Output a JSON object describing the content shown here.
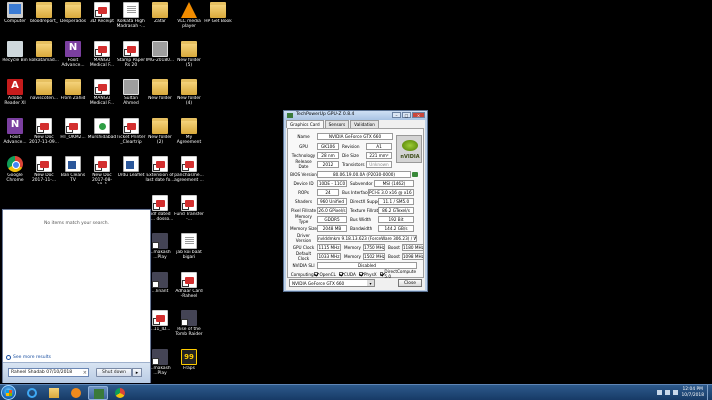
{
  "desktop": {
    "icons": [
      {
        "label": "Computer",
        "type": "computer",
        "col": 0,
        "row": 0
      },
      {
        "label": "bloodreport_",
        "type": "folder",
        "col": 1,
        "row": 0
      },
      {
        "label": "Desperados",
        "type": "folder",
        "col": 2,
        "row": 0
      },
      {
        "label": "3D Receipt",
        "type": "pdf",
        "col": 3,
        "row": 0
      },
      {
        "label": "Kolkata High Madrasah -...",
        "type": "doc",
        "col": 4,
        "row": 0
      },
      {
        "label": "Zafar",
        "type": "folder",
        "col": 5,
        "row": 0
      },
      {
        "label": "VLC media player",
        "type": "vlc",
        "col": 6,
        "row": 0
      },
      {
        "label": "HP Get Book",
        "type": "folder",
        "col": 7,
        "row": 0
      },
      {
        "label": "Recycle Bin",
        "type": "recycle",
        "col": 0,
        "row": 1
      },
      {
        "label": "kolkatamad...",
        "type": "folder",
        "col": 1,
        "row": 1
      },
      {
        "label": "Foxit Advance...",
        "type": "onenote",
        "col": 2,
        "row": 1
      },
      {
        "label": "MANGU Medical F...",
        "type": "pdf",
        "col": 3,
        "row": 1
      },
      {
        "label": "Stamp Paper Rs 20",
        "type": "pdf",
        "col": 4,
        "row": 1
      },
      {
        "label": "IMG-20180...",
        "type": "image",
        "col": 5,
        "row": 1
      },
      {
        "label": "New folder (5)",
        "type": "folder",
        "col": 6,
        "row": 1
      },
      {
        "label": "Adobe Reader XI",
        "type": "adobe",
        "col": 0,
        "row": 2
      },
      {
        "label": "naviscoten...",
        "type": "folder",
        "col": 1,
        "row": 2
      },
      {
        "label": "From Zahid",
        "type": "folder",
        "col": 2,
        "row": 2
      },
      {
        "label": "MANGU Medical F...",
        "type": "pdf",
        "col": 3,
        "row": 2
      },
      {
        "label": "Sultan Ahmed",
        "type": "image",
        "col": 4,
        "row": 2
      },
      {
        "label": "New folder",
        "type": "folder",
        "col": 5,
        "row": 2
      },
      {
        "label": "New folder (4)",
        "type": "folder",
        "col": 6,
        "row": 2
      },
      {
        "label": "Foxit Advance...",
        "type": "onenote",
        "col": 0,
        "row": 3
      },
      {
        "label": "New Doc 2017-11-09...",
        "type": "pdf",
        "col": 1,
        "row": 3
      },
      {
        "label": "HT_OKM2...",
        "type": "pdf",
        "col": 2,
        "row": 3
      },
      {
        "label": "Murshidabad",
        "type": "green",
        "col": 3,
        "row": 3
      },
      {
        "label": "Ticket Printer _Cleartrip",
        "type": "pdf",
        "col": 4,
        "row": 3
      },
      {
        "label": "New folder (2)",
        "type": "folder",
        "col": 5,
        "row": 3
      },
      {
        "label": "My Agreement",
        "type": "folder",
        "col": 6,
        "row": 3
      },
      {
        "label": "Google Chrome",
        "type": "chrome",
        "col": 0,
        "row": 4
      },
      {
        "label": "New Doc 2017-11-...",
        "type": "pdf",
        "col": 1,
        "row": 4
      },
      {
        "label": "Bali Cleans TV",
        "type": "word",
        "col": 2,
        "row": 4
      },
      {
        "label": "New Doc 2017-08-18_1",
        "type": "pdf",
        "col": 3,
        "row": 4
      },
      {
        "label": "Urdu Leaflet",
        "type": "word",
        "col": 4,
        "row": 4
      },
      {
        "label": "Extension of last date fo...",
        "type": "pdf",
        "col": 5,
        "row": 4
      },
      {
        "label": "panchasme... agreement ...",
        "type": "pdf",
        "col": 6,
        "row": 4
      },
      {
        "label": "pdf dated 2/...  dosso...",
        "type": "pdf",
        "col": 5,
        "row": 5
      },
      {
        "label": "Fund Transfer -...",
        "type": "pdf",
        "col": 6,
        "row": 5
      },
      {
        "label": "...makash ...Play",
        "type": "game",
        "col": 5,
        "row": 6
      },
      {
        "label": "jab koi baat bigari",
        "type": "doc",
        "col": 6,
        "row": 6
      },
      {
        "label": "...linant",
        "type": "game",
        "col": 5,
        "row": 7
      },
      {
        "label": "Adhaar Card -Raheel",
        "type": "pdf",
        "col": 6,
        "row": 7
      },
      {
        "label": "...11_ID...",
        "type": "pdf",
        "col": 5,
        "row": 8
      },
      {
        "label": "Rise of the Tomb Raider",
        "type": "game",
        "col": 6,
        "row": 8
      },
      {
        "label": "...makash ...Play",
        "type": "game",
        "col": 5,
        "row": 9
      },
      {
        "label": "Fraps",
        "type": "fraps",
        "col": 6,
        "row": 9
      }
    ]
  },
  "start_menu": {
    "no_items_text": "No items match your search.",
    "see_more_label": "See more results",
    "search_value": "Raheel Shadab 07/10/2018",
    "search_clear": "×",
    "shutdown_label": "Shut down",
    "shutdown_arrow": "▸"
  },
  "gpuz": {
    "title": "TechPowerUp GPU-Z 0.8.4",
    "win_min": "–",
    "win_max": "□",
    "win_close": "×",
    "tabs": [
      "Graphics Card",
      "Sensors",
      "Validation"
    ],
    "fields": {
      "name_label": "Name",
      "name": "NVIDIA GeForce GTX 660",
      "gpu_label": "GPU",
      "gpu": "GK106",
      "revision_label": "Revision",
      "revision": "A1",
      "technology_label": "Technology",
      "technology": "28 nm",
      "die_size_label": "Die Size",
      "die_size": "221 mm²",
      "release_label": "Release Date",
      "release": "2012",
      "transistors_label": "Transistors",
      "transistors": "Unknown",
      "bios_label": "BIOS Version",
      "bios": "80.06.19.00.0A (P2030-0000)",
      "device_id_label": "Device ID",
      "device_id": "10DE - 11C0",
      "subvendor_label": "Subvendor",
      "subvendor": "MSI (1462)",
      "rops_label": "ROPs",
      "rops": "24",
      "bus_label": "Bus Interface",
      "bus": "PCI-E 3.0 x16 @ x16 3.0",
      "shaders_label": "Shaders",
      "shaders": "960 Unified",
      "directx_label": "DirectX Support",
      "directx": "11.1 / SM5.0",
      "pixel_label": "Pixel Fillrate",
      "pixel": "26.0 GPixel/s",
      "texture_label": "Texture Fillrate",
      "texture": "86.2 GTexel/s",
      "memtype_label": "Memory Type",
      "memtype": "GDDR5",
      "buswidth_label": "Bus Width",
      "buswidth": "192 Bit",
      "memsize_label": "Memory Size",
      "memsize": "2048 MB",
      "bandwidth_label": "Bandwidth",
      "bandwidth": "144.2 GB/s",
      "driver_label": "Driver Version",
      "driver": "nvlddmkm 9.18.13.623 (ForceWare 306.23) / Win7 64",
      "gpuclock_label": "GPU Clock",
      "gpuclock": "1115 MHz",
      "memory_label": "Memory",
      "gpu_mem": "1750 MHz",
      "boost_label": "Boost",
      "gpu_boost": "1180 MHz",
      "defclock_label": "Default Clock",
      "defclock": "1033 MHz",
      "def_mem": "1502 MHz",
      "def_boost": "1098 MHz",
      "sli_label": "NVIDIA SLI",
      "sli": "Disabled",
      "computing_label": "Computing",
      "computing": [
        "OpenCL",
        "CUDA",
        "PhysX",
        "DirectCompute 5.0"
      ]
    },
    "logo_text": "nVIDIA",
    "selected_gpu": "NVIDIA GeForce GTX 660",
    "select_arrow": "▾",
    "close_label": "Close"
  },
  "taskbar": {
    "clock_time": "12:04 PM",
    "clock_date": "10/7/2018"
  }
}
